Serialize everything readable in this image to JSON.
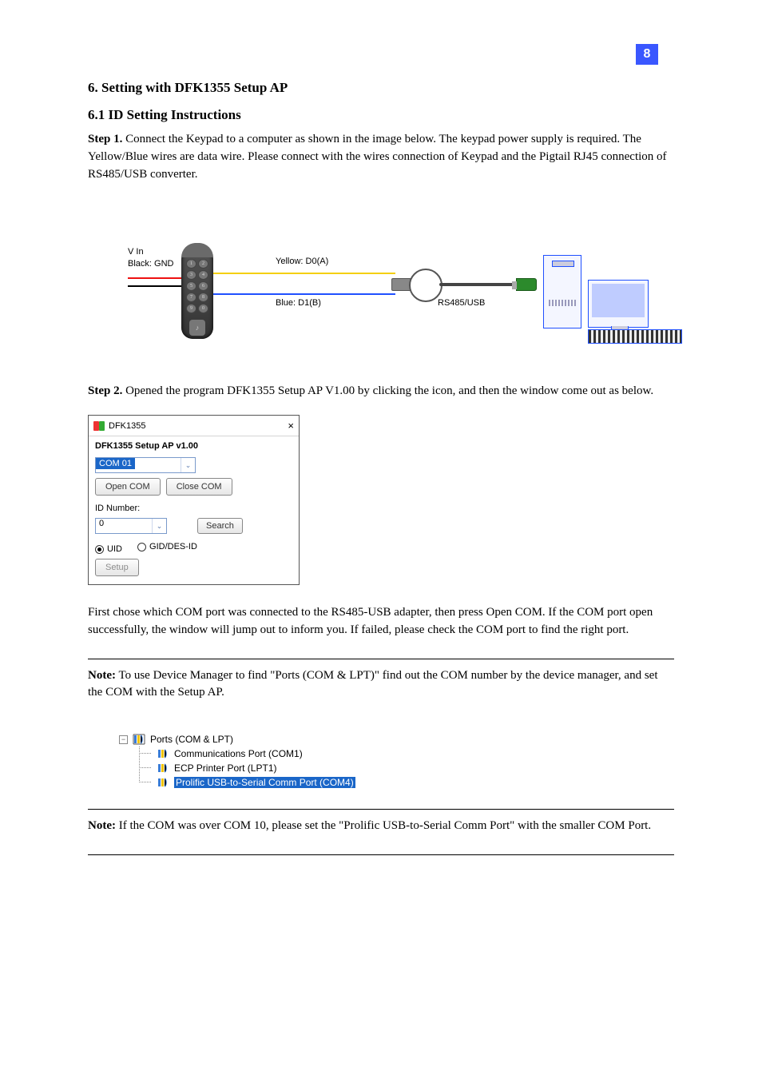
{
  "page_number": "8",
  "section_title": "6. Setting with DFK1355 Setup AP",
  "sub_step1": "6.1 ID Setting Instructions",
  "p1_lead": "Step 1.",
  "p1": " Connect the Keypad to a computer as shown in the image below. The keypad power supply is required. The Yellow/Blue wires are data wire. Please connect with the wires connection of Keypad and the Pigtail RJ45 connection of RS485/USB converter.",
  "wires": {
    "v_in": "V In",
    "black_gnd": "Black: GND",
    "yellow_d0": "Yellow: D0(A)",
    "blue_d1": "Blue: D1(B)",
    "rs485_usb": "RS485/USB"
  },
  "p2_lead": "Step 2.",
  "p2": " Opened the program DFK1355 Setup AP V1.00 by clicking the icon, and then the window come out as below.",
  "app": {
    "title": "DFK1355",
    "heading": "DFK1355 Setup AP   v1.00",
    "com_selected": "COM 01",
    "open_com": "Open COM",
    "close_com": "Close COM",
    "id_number_label": "ID Number:",
    "id_value": "0",
    "search": "Search",
    "uid": "UID",
    "giddes": "GID/DES-ID",
    "setup": "Setup"
  },
  "p3": "First chose which COM port was connected to the RS485-USB adapter, then press Open COM. If the COM port open successfully, the window will jump out to inform you. If failed, please check the COM port to find the right port.",
  "note_bold": "Note:",
  "note1a": " To use Device Manager to find ",
  "note1_q1": "\"",
  "note1b": "Ports (COM & LPT)",
  "note1_q2": "\"",
  "note1c": " find out the COM number by the device manager, and set the COM with the Setup AP.",
  "dm": {
    "root": "Ports (COM & LPT)",
    "item1": "Communications Port (COM1)",
    "item2": "ECP Printer Port (LPT1)",
    "item3": "Prolific USB-to-Serial Comm Port (COM4)"
  },
  "note2a": " If the COM was over COM 10, please set the ",
  "note2_q1": "\"",
  "note2b": "Prolific USB-to-Serial Comm Port",
  "note2_q2": "\"",
  "note2c": " with the smaller COM Port."
}
